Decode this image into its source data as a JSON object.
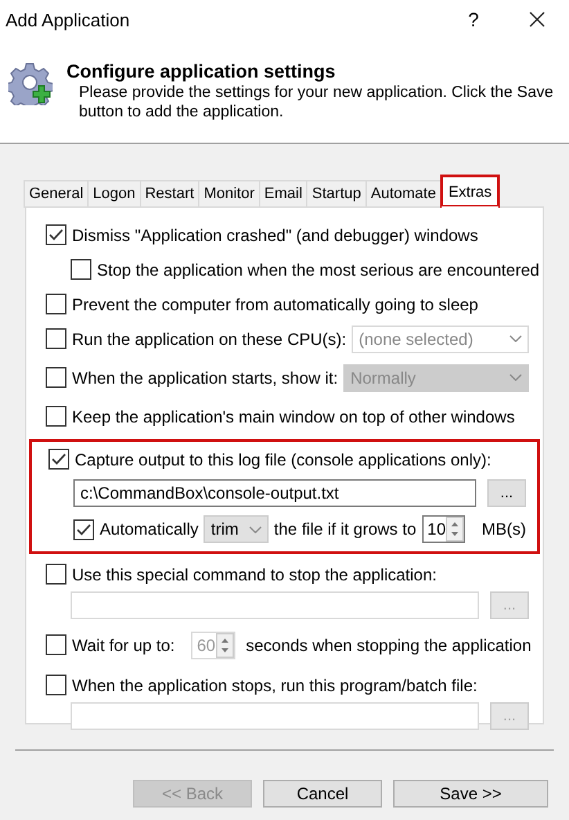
{
  "window": {
    "title": "Add Application",
    "help": "?"
  },
  "header": {
    "title": "Configure application settings",
    "description": "Please provide the settings for your new application. Click the Save button to add the application."
  },
  "tabs": [
    {
      "label": "General",
      "selected": false,
      "highlighted": false
    },
    {
      "label": "Logon",
      "selected": false,
      "highlighted": false
    },
    {
      "label": "Restart",
      "selected": false,
      "highlighted": false
    },
    {
      "label": "Monitor",
      "selected": false,
      "highlighted": false
    },
    {
      "label": "Email",
      "selected": false,
      "highlighted": false
    },
    {
      "label": "Startup",
      "selected": false,
      "highlighted": false
    },
    {
      "label": "Automate",
      "selected": false,
      "highlighted": false
    },
    {
      "label": "Extras",
      "selected": true,
      "highlighted": true
    }
  ],
  "options": [
    {
      "kind": "checkbox",
      "label": "Dismiss \"Application crashed\" (and debugger) windows",
      "checked": true,
      "children": [
        {
          "kind": "checkbox",
          "label": "Stop the application when the most serious are encountered",
          "checked": false
        }
      ]
    },
    {
      "kind": "checkbox",
      "label": "Prevent the computer from automatically going to sleep",
      "checked": false
    },
    {
      "kind": "select",
      "label": "Run the application on these CPU(s):",
      "checked": false,
      "select": {
        "placeholder": "(none selected)",
        "disabled": false
      }
    },
    {
      "kind": "select",
      "label": "When the application starts, show it:",
      "checked": false,
      "select": {
        "value": "Normally",
        "disabled": true
      }
    },
    {
      "kind": "checkbox",
      "label": "Keep the application's main window on top of other windows",
      "checked": false
    },
    {
      "kind": "log",
      "highlighted": true,
      "label": "Capture output to this log file (console applications only):",
      "checked": true,
      "path": "c:\\CommandBox\\console-output.txt",
      "browse": "...",
      "auto": {
        "label": "Automatically",
        "checked": true,
        "action": "trim",
        "text": "the file if it grows to",
        "size": "10",
        "unit": "MB(s)"
      }
    },
    {
      "kind": "field",
      "label": "Use this special command to stop the application:",
      "checked": false,
      "browse": "...",
      "disabled": true
    },
    {
      "kind": "wait",
      "label": "Wait for up to:",
      "checked": false,
      "value": "60",
      "disabled": true,
      "suffix": "seconds when stopping the application"
    },
    {
      "kind": "field",
      "label": "When the application stops, run this program/batch file:",
      "checked": false,
      "browse": "...",
      "disabled": true
    }
  ],
  "buttons": [
    {
      "label": "<< Back",
      "disabled": true
    },
    {
      "label": "Cancel",
      "disabled": false
    },
    {
      "label": "Save >>",
      "disabled": false
    }
  ]
}
